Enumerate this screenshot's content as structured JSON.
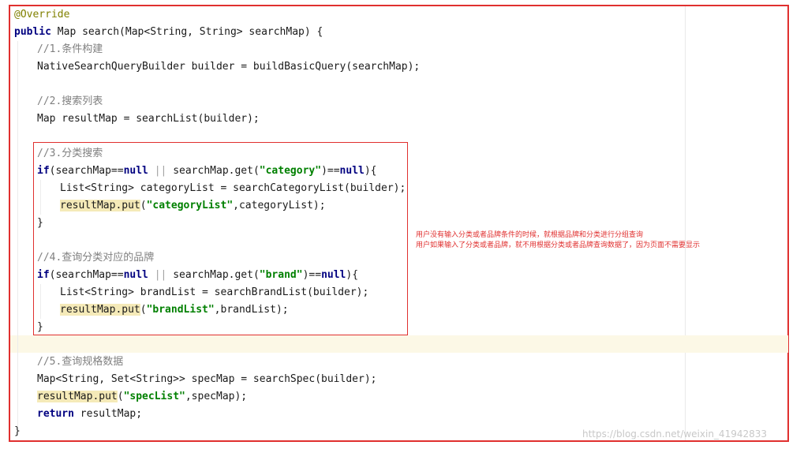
{
  "code_lines": [
    {
      "indent": 0,
      "parts": [
        {
          "t": "@Override",
          "c": "an"
        }
      ]
    },
    {
      "indent": 0,
      "parts": [
        {
          "t": "public",
          "c": "kw"
        },
        {
          "t": " Map search(Map<String, String> searchMap) {",
          "c": ""
        }
      ]
    },
    {
      "indent": 1,
      "parts": [
        {
          "t": "//1.条件构建",
          "c": "cm"
        }
      ]
    },
    {
      "indent": 1,
      "parts": [
        {
          "t": "NativeSearchQueryBuilder builder = buildBasicQuery(searchMap);",
          "c": ""
        }
      ]
    },
    {
      "indent": 0,
      "parts": []
    },
    {
      "indent": 1,
      "parts": [
        {
          "t": "//2.搜索列表",
          "c": "cm"
        }
      ]
    },
    {
      "indent": 1,
      "parts": [
        {
          "t": "Map resultMap = searchList(builder);",
          "c": ""
        }
      ]
    },
    {
      "indent": 0,
      "parts": []
    },
    {
      "indent": 1,
      "parts": [
        {
          "t": "//3.分类搜索",
          "c": "cm"
        }
      ]
    },
    {
      "indent": 1,
      "parts": [
        {
          "t": "if",
          "c": "kw"
        },
        {
          "t": "(searchMap==",
          "c": ""
        },
        {
          "t": "null",
          "c": "kw"
        },
        {
          "t": " || ",
          "c": "cb"
        },
        {
          "t": "searchMap.get(",
          "c": ""
        },
        {
          "t": "\"category\"",
          "c": "str"
        },
        {
          "t": ")==",
          "c": ""
        },
        {
          "t": "null",
          "c": "kw"
        },
        {
          "t": "){",
          "c": ""
        }
      ]
    },
    {
      "indent": 2,
      "parts": [
        {
          "t": "List<String> categoryList = searchCategoryList(builder);",
          "c": ""
        }
      ]
    },
    {
      "indent": 2,
      "parts": [
        {
          "t": "resultMap.put",
          "c": "hl"
        },
        {
          "t": "(",
          "c": ""
        },
        {
          "t": "\"categoryList\"",
          "c": "str"
        },
        {
          "t": ",categoryList);",
          "c": ""
        }
      ]
    },
    {
      "indent": 1,
      "parts": [
        {
          "t": "}",
          "c": ""
        }
      ]
    },
    {
      "indent": 0,
      "parts": []
    },
    {
      "indent": 1,
      "parts": [
        {
          "t": "//4.查询分类对应的品牌",
          "c": "cm"
        }
      ]
    },
    {
      "indent": 1,
      "parts": [
        {
          "t": "if",
          "c": "kw"
        },
        {
          "t": "(searchMap==",
          "c": ""
        },
        {
          "t": "null",
          "c": "kw"
        },
        {
          "t": " || ",
          "c": "cb"
        },
        {
          "t": "searchMap.get(",
          "c": ""
        },
        {
          "t": "\"brand\"",
          "c": "str"
        },
        {
          "t": ")==",
          "c": ""
        },
        {
          "t": "null",
          "c": "kw"
        },
        {
          "t": "){",
          "c": ""
        }
      ]
    },
    {
      "indent": 2,
      "parts": [
        {
          "t": "List<String> brandList = searchBrandList(builder);",
          "c": ""
        }
      ]
    },
    {
      "indent": 2,
      "parts": [
        {
          "t": "resultMap.put",
          "c": "hl"
        },
        {
          "t": "(",
          "c": ""
        },
        {
          "t": "\"brandList\"",
          "c": "str"
        },
        {
          "t": ",brandList);",
          "c": ""
        }
      ]
    },
    {
      "indent": 1,
      "parts": [
        {
          "t": "}",
          "c": ""
        }
      ]
    },
    {
      "indent": 0,
      "parts": []
    },
    {
      "indent": 1,
      "parts": [
        {
          "t": "//5.查询规格数据",
          "c": "cm"
        }
      ]
    },
    {
      "indent": 1,
      "parts": [
        {
          "t": "Map<String, Set<String>> specMap = searchSpec(builder);",
          "c": ""
        }
      ]
    },
    {
      "indent": 1,
      "parts": [
        {
          "t": "resultMap.put",
          "c": "hl"
        },
        {
          "t": "(",
          "c": ""
        },
        {
          "t": "\"specList\"",
          "c": "str"
        },
        {
          "t": ",specMap);",
          "c": ""
        }
      ]
    },
    {
      "indent": 1,
      "parts": [
        {
          "t": "return",
          "c": "kw"
        },
        {
          "t": " resultMap;",
          "c": ""
        }
      ]
    },
    {
      "indent": 0,
      "parts": [
        {
          "t": "}",
          "c": ""
        }
      ]
    }
  ],
  "annotation": {
    "line1": "用户没有输入分类或者品牌条件的时候，就根据品牌和分类进行分组查询",
    "line2": "用户如果输入了分类或者品牌，就不用根据分类或者品牌查询数据了，因为页面不需要显示"
  },
  "watermark": "https://blog.csdn.net/weixin_41942833",
  "colors": {
    "border_red": "#e0302f",
    "keyword": "#000080",
    "string": "#008000",
    "comment": "#808080",
    "annotation": "#808000",
    "method_highlight": "#f5eab8",
    "caret_line": "#fcf8e6"
  }
}
